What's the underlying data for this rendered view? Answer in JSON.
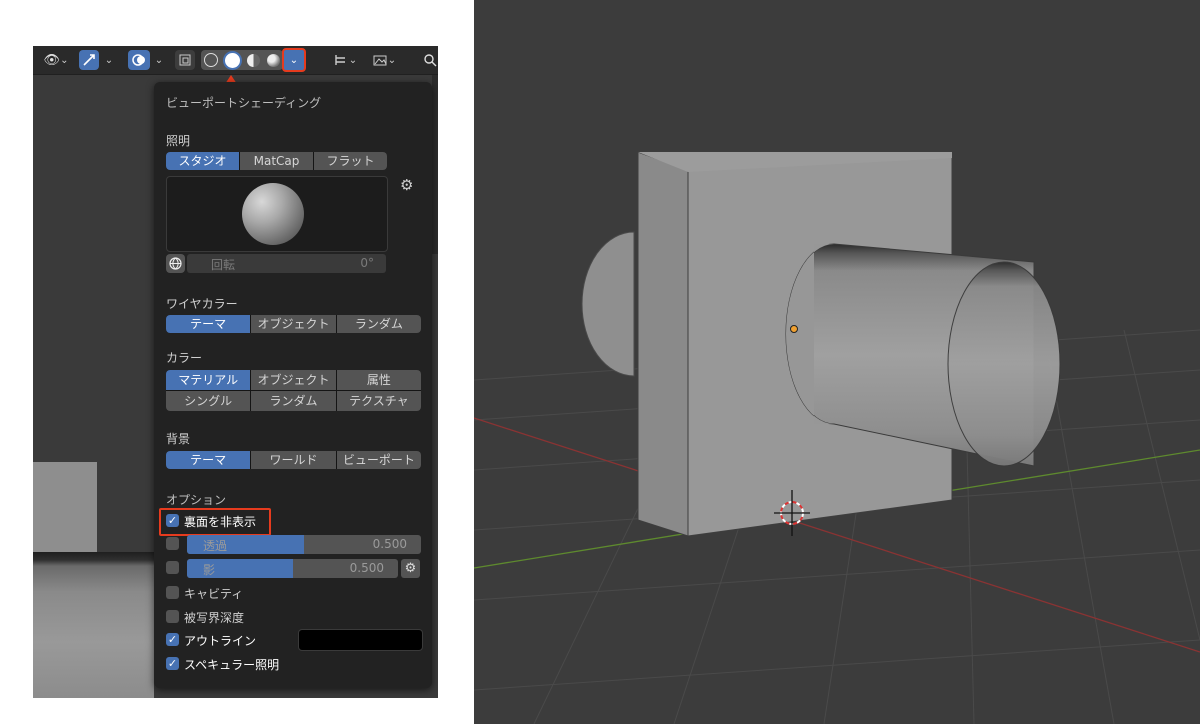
{
  "header": {
    "icons": [
      "visibility-icon",
      "gizmo-icon",
      "overlay-icon",
      "xray-icon",
      "wireframe-shading-icon",
      "solid-shading-icon",
      "material-shading-icon",
      "rendered-shading-icon",
      "shading-popover-chevron",
      "editor-type-icon",
      "image-icon",
      "search-icon"
    ]
  },
  "panel": {
    "title": "ビューポートシェーディング",
    "lighting": {
      "label": "照明",
      "options": [
        "スタジオ",
        "MatCap",
        "フラット"
      ],
      "selected": "スタジオ",
      "rotation_label": "回転",
      "rotation_value": "0°"
    },
    "wire_color": {
      "label": "ワイヤカラー",
      "options": [
        "テーマ",
        "オブジェクト",
        "ランダム"
      ],
      "selected": "テーマ"
    },
    "color": {
      "label": "カラー",
      "options": [
        "マテリアル",
        "オブジェクト",
        "属性",
        "シングル",
        "ランダム",
        "テクスチャ"
      ],
      "selected": "マテリアル"
    },
    "background": {
      "label": "背景",
      "options": [
        "テーマ",
        "ワールド",
        "ビューポート"
      ],
      "selected": "テーマ"
    },
    "options": {
      "label": "オプション",
      "backface_culling": "裏面を非表示",
      "xray_label": "透過",
      "xray_value": "0.500",
      "xray_fraction": 0.5,
      "shadow_label": "影",
      "shadow_value": "0.500",
      "shadow_fraction": 0.5,
      "cavity": "キャビティ",
      "dof": "被写界深度",
      "outline": "アウトライン",
      "specular": "スペキュラー照明"
    }
  },
  "colors": {
    "accent": "#4772b3",
    "highlight_red": "#e63b1e",
    "panel_bg": "#222222",
    "viewport_bg": "#3c3c3c"
  }
}
